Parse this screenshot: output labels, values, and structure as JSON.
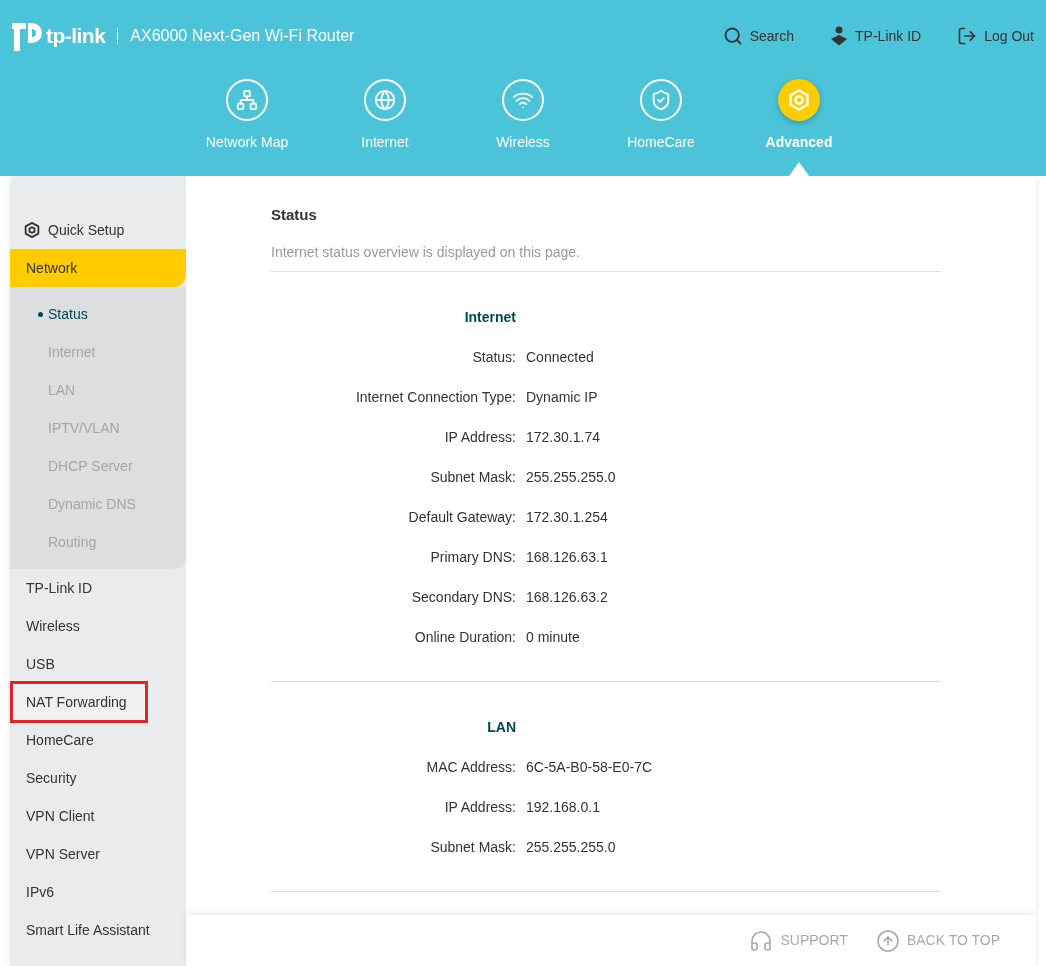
{
  "header": {
    "brand": "tp-link",
    "model": "AX6000 Next-Gen Wi-Fi Router",
    "actions": [
      {
        "kind": "search",
        "label": "Search"
      },
      {
        "kind": "account",
        "label": "TP-Link ID"
      },
      {
        "kind": "logout",
        "label": "Log Out"
      }
    ]
  },
  "nav": [
    {
      "kind": "network-map",
      "label": "Network Map",
      "selected": false
    },
    {
      "kind": "internet",
      "label": "Internet",
      "selected": false
    },
    {
      "kind": "wireless",
      "label": "Wireless",
      "selected": false
    },
    {
      "kind": "homecare",
      "label": "HomeCare",
      "selected": false
    },
    {
      "kind": "advanced",
      "label": "Advanced",
      "selected": true
    }
  ],
  "sidebar": {
    "quick_setup": "Quick Setup",
    "items": [
      {
        "label": "Network",
        "selected": true,
        "highlighted": false,
        "children": [
          {
            "label": "Status",
            "selected": true
          },
          {
            "label": "Internet",
            "selected": false
          },
          {
            "label": "LAN",
            "selected": false
          },
          {
            "label": "IPTV/VLAN",
            "selected": false
          },
          {
            "label": "DHCP Server",
            "selected": false
          },
          {
            "label": "Dynamic DNS",
            "selected": false
          },
          {
            "label": "Routing",
            "selected": false
          }
        ]
      },
      {
        "label": "TP-Link ID",
        "selected": false,
        "highlighted": false
      },
      {
        "label": "Wireless",
        "selected": false,
        "highlighted": false
      },
      {
        "label": "USB",
        "selected": false,
        "highlighted": false
      },
      {
        "label": "NAT Forwarding",
        "selected": false,
        "highlighted": true
      },
      {
        "label": "HomeCare",
        "selected": false,
        "highlighted": false
      },
      {
        "label": "Security",
        "selected": false,
        "highlighted": false
      },
      {
        "label": "VPN Client",
        "selected": false,
        "highlighted": false
      },
      {
        "label": "VPN Server",
        "selected": false,
        "highlighted": false
      },
      {
        "label": "IPv6",
        "selected": false,
        "highlighted": false
      },
      {
        "label": "Smart Life Assistant",
        "selected": false,
        "highlighted": false
      }
    ]
  },
  "content": {
    "title": "Status",
    "description": "Internet status overview is displayed on this page.",
    "sections": [
      {
        "heading": "Internet",
        "rows": [
          {
            "label": "Status:",
            "value": "Connected"
          },
          {
            "label": "Internet Connection Type:",
            "value": "Dynamic IP"
          },
          {
            "label": "IP Address:",
            "value": "172.30.1.74"
          },
          {
            "label": "Subnet Mask:",
            "value": "255.255.255.0"
          },
          {
            "label": "Default Gateway:",
            "value": "172.30.1.254"
          },
          {
            "label": "Primary DNS:",
            "value": "168.126.63.1"
          },
          {
            "label": "Secondary DNS:",
            "value": "168.126.63.2"
          },
          {
            "label": "Online Duration:",
            "value": "0 minute"
          }
        ]
      },
      {
        "heading": "LAN",
        "rows": [
          {
            "label": "MAC Address:",
            "value": "6C-5A-B0-58-E0-7C"
          },
          {
            "label": "IP Address:",
            "value": "192.168.0.1"
          },
          {
            "label": "Subnet Mask:",
            "value": "255.255.255.0"
          }
        ]
      }
    ]
  },
  "footer": {
    "links": [
      {
        "kind": "support",
        "label": "SUPPORT"
      },
      {
        "kind": "top",
        "label": "BACK TO TOP"
      }
    ]
  }
}
